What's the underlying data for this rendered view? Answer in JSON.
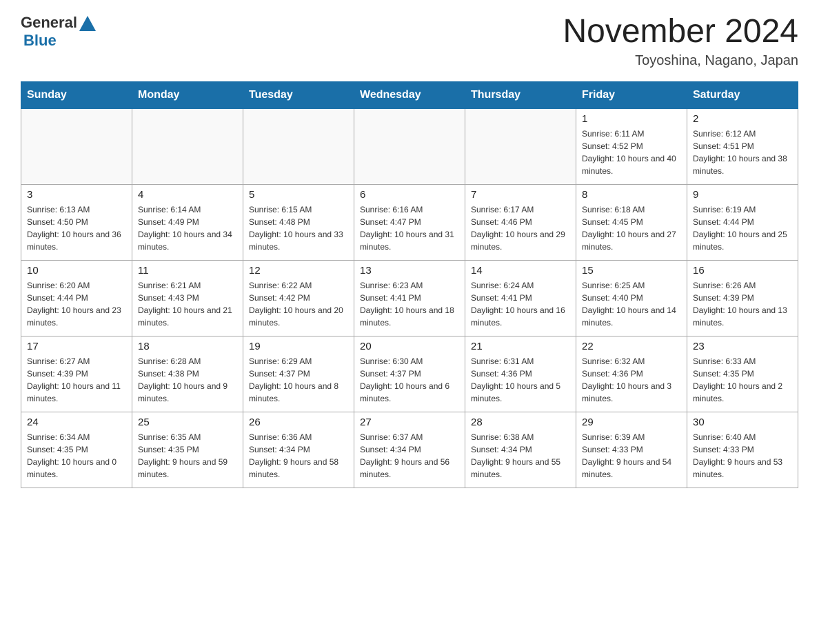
{
  "header": {
    "logo_general": "General",
    "logo_blue": "Blue",
    "title": "November 2024",
    "subtitle": "Toyoshina, Nagano, Japan"
  },
  "weekdays": [
    "Sunday",
    "Monday",
    "Tuesday",
    "Wednesday",
    "Thursday",
    "Friday",
    "Saturday"
  ],
  "weeks": [
    [
      {
        "day": "",
        "info": ""
      },
      {
        "day": "",
        "info": ""
      },
      {
        "day": "",
        "info": ""
      },
      {
        "day": "",
        "info": ""
      },
      {
        "day": "",
        "info": ""
      },
      {
        "day": "1",
        "info": "Sunrise: 6:11 AM\nSunset: 4:52 PM\nDaylight: 10 hours and 40 minutes."
      },
      {
        "day": "2",
        "info": "Sunrise: 6:12 AM\nSunset: 4:51 PM\nDaylight: 10 hours and 38 minutes."
      }
    ],
    [
      {
        "day": "3",
        "info": "Sunrise: 6:13 AM\nSunset: 4:50 PM\nDaylight: 10 hours and 36 minutes."
      },
      {
        "day": "4",
        "info": "Sunrise: 6:14 AM\nSunset: 4:49 PM\nDaylight: 10 hours and 34 minutes."
      },
      {
        "day": "5",
        "info": "Sunrise: 6:15 AM\nSunset: 4:48 PM\nDaylight: 10 hours and 33 minutes."
      },
      {
        "day": "6",
        "info": "Sunrise: 6:16 AM\nSunset: 4:47 PM\nDaylight: 10 hours and 31 minutes."
      },
      {
        "day": "7",
        "info": "Sunrise: 6:17 AM\nSunset: 4:46 PM\nDaylight: 10 hours and 29 minutes."
      },
      {
        "day": "8",
        "info": "Sunrise: 6:18 AM\nSunset: 4:45 PM\nDaylight: 10 hours and 27 minutes."
      },
      {
        "day": "9",
        "info": "Sunrise: 6:19 AM\nSunset: 4:44 PM\nDaylight: 10 hours and 25 minutes."
      }
    ],
    [
      {
        "day": "10",
        "info": "Sunrise: 6:20 AM\nSunset: 4:44 PM\nDaylight: 10 hours and 23 minutes."
      },
      {
        "day": "11",
        "info": "Sunrise: 6:21 AM\nSunset: 4:43 PM\nDaylight: 10 hours and 21 minutes."
      },
      {
        "day": "12",
        "info": "Sunrise: 6:22 AM\nSunset: 4:42 PM\nDaylight: 10 hours and 20 minutes."
      },
      {
        "day": "13",
        "info": "Sunrise: 6:23 AM\nSunset: 4:41 PM\nDaylight: 10 hours and 18 minutes."
      },
      {
        "day": "14",
        "info": "Sunrise: 6:24 AM\nSunset: 4:41 PM\nDaylight: 10 hours and 16 minutes."
      },
      {
        "day": "15",
        "info": "Sunrise: 6:25 AM\nSunset: 4:40 PM\nDaylight: 10 hours and 14 minutes."
      },
      {
        "day": "16",
        "info": "Sunrise: 6:26 AM\nSunset: 4:39 PM\nDaylight: 10 hours and 13 minutes."
      }
    ],
    [
      {
        "day": "17",
        "info": "Sunrise: 6:27 AM\nSunset: 4:39 PM\nDaylight: 10 hours and 11 minutes."
      },
      {
        "day": "18",
        "info": "Sunrise: 6:28 AM\nSunset: 4:38 PM\nDaylight: 10 hours and 9 minutes."
      },
      {
        "day": "19",
        "info": "Sunrise: 6:29 AM\nSunset: 4:37 PM\nDaylight: 10 hours and 8 minutes."
      },
      {
        "day": "20",
        "info": "Sunrise: 6:30 AM\nSunset: 4:37 PM\nDaylight: 10 hours and 6 minutes."
      },
      {
        "day": "21",
        "info": "Sunrise: 6:31 AM\nSunset: 4:36 PM\nDaylight: 10 hours and 5 minutes."
      },
      {
        "day": "22",
        "info": "Sunrise: 6:32 AM\nSunset: 4:36 PM\nDaylight: 10 hours and 3 minutes."
      },
      {
        "day": "23",
        "info": "Sunrise: 6:33 AM\nSunset: 4:35 PM\nDaylight: 10 hours and 2 minutes."
      }
    ],
    [
      {
        "day": "24",
        "info": "Sunrise: 6:34 AM\nSunset: 4:35 PM\nDaylight: 10 hours and 0 minutes."
      },
      {
        "day": "25",
        "info": "Sunrise: 6:35 AM\nSunset: 4:35 PM\nDaylight: 9 hours and 59 minutes."
      },
      {
        "day": "26",
        "info": "Sunrise: 6:36 AM\nSunset: 4:34 PM\nDaylight: 9 hours and 58 minutes."
      },
      {
        "day": "27",
        "info": "Sunrise: 6:37 AM\nSunset: 4:34 PM\nDaylight: 9 hours and 56 minutes."
      },
      {
        "day": "28",
        "info": "Sunrise: 6:38 AM\nSunset: 4:34 PM\nDaylight: 9 hours and 55 minutes."
      },
      {
        "day": "29",
        "info": "Sunrise: 6:39 AM\nSunset: 4:33 PM\nDaylight: 9 hours and 54 minutes."
      },
      {
        "day": "30",
        "info": "Sunrise: 6:40 AM\nSunset: 4:33 PM\nDaylight: 9 hours and 53 minutes."
      }
    ]
  ]
}
